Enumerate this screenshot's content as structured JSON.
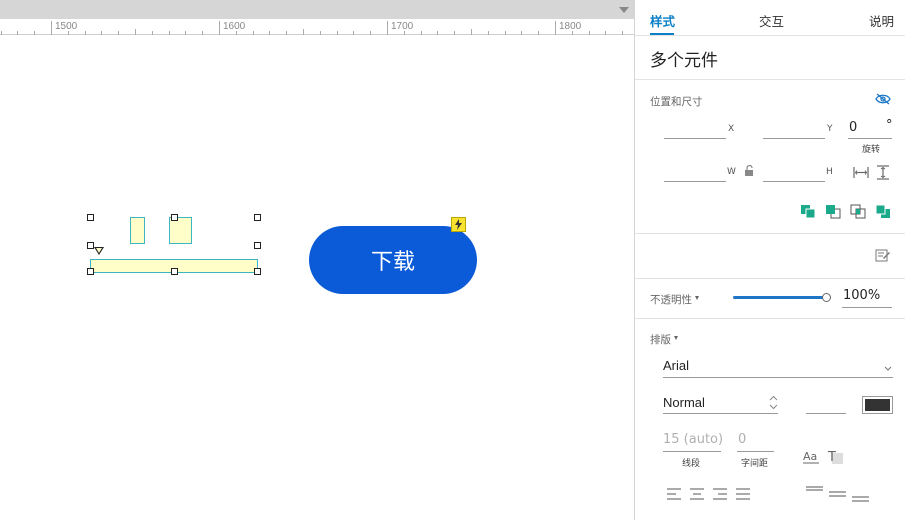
{
  "ruler": {
    "labels": [
      "1500",
      "1600",
      "1700",
      "1800"
    ]
  },
  "canvas": {
    "button_label": "下载"
  },
  "tabs": {
    "style": "样式",
    "interaction": "交互",
    "notes": "说明"
  },
  "panel": {
    "title": "多个元件",
    "position_size": {
      "label": "位置和尺寸",
      "x_label": "X",
      "y_label": "Y",
      "w_label": "W",
      "h_label": "H",
      "rotation_value": "0",
      "rotation_unit": "°",
      "rotation_label": "旋转"
    },
    "opacity": {
      "label": "不透明性",
      "value": "100%",
      "level": 1.0
    },
    "typography": {
      "label": "排版",
      "font_family": "Arial",
      "font_style": "Normal",
      "font_size": "",
      "line_height_placeholder": "15 (auto)",
      "line_height_label": "线段",
      "letter_spacing_placeholder": "0",
      "letter_spacing_label": "字间距",
      "text_color": "#333333"
    }
  },
  "colors": {
    "accent": "#0b7fc7",
    "button": "#0b5bd8",
    "selection_fill": "#fffdc8",
    "selection_border": "#3bb6c2",
    "arrange_icon": "#1aa98a"
  }
}
